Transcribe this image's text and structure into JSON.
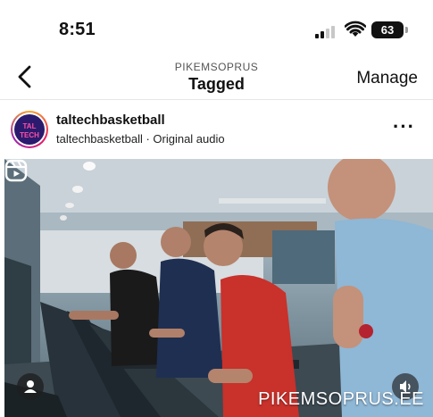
{
  "status_bar": {
    "time": "8:51",
    "battery": "63"
  },
  "nav": {
    "account": "PIKEMSOPRUS",
    "title": "Tagged",
    "manage_label": "Manage"
  },
  "post": {
    "avatar_text": "TAL TECH",
    "username": "taltechbasketball",
    "subline": "taltechbasketball · Original audio",
    "more_label": "···",
    "media": {
      "watermark": "PIKEMSOPRUS.EE"
    }
  },
  "icons": [
    "back-chevron-icon",
    "signal-icon",
    "wifi-icon",
    "battery-icon",
    "reel-icon",
    "user-tag-icon",
    "sound-icon",
    "more-icon"
  ]
}
